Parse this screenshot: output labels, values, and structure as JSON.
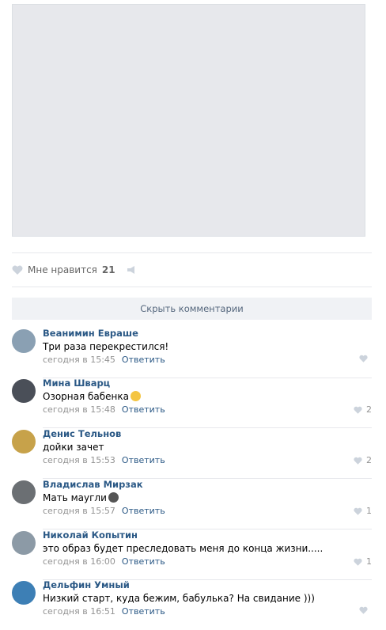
{
  "post": {
    "likes_label": "Мне нравится",
    "likes_count": "21"
  },
  "comments_toggle": "Скрыть комментарии",
  "comments": [
    {
      "name": "Веанимин Евраше",
      "text": "Три раза перекрестился!",
      "time": "сегодня в 15:45",
      "reply": "Ответить",
      "likes": ""
    },
    {
      "name": "Мина Шварц",
      "text": "Озорная бабенка",
      "time": "сегодня в 15:48",
      "reply": "Ответить",
      "likes": "2"
    },
    {
      "name": "Денис Тельнов",
      "text": "дойки зачет",
      "time": "сегодня в 15:53",
      "reply": "Ответить",
      "likes": "2"
    },
    {
      "name": "Владислав Мирзак",
      "text": "Мать маугли",
      "time": "сегодня в 15:57",
      "reply": "Ответить",
      "likes": "1"
    },
    {
      "name": "Николай Копытин",
      "text": "это образ будет преследовать меня до конца жизни.....",
      "time": "сегодня в 16:00",
      "reply": "Ответить",
      "likes": "1"
    },
    {
      "name": "Дельфин Умный",
      "text": "Низкий старт, куда бежим, бабулька? На свидание )))",
      "time": "сегодня в 16:51",
      "reply": "Ответить",
      "likes": ""
    }
  ],
  "colors": {
    "link": "#2a5885",
    "meta": "#939393",
    "heart": "#ccd3dc"
  }
}
